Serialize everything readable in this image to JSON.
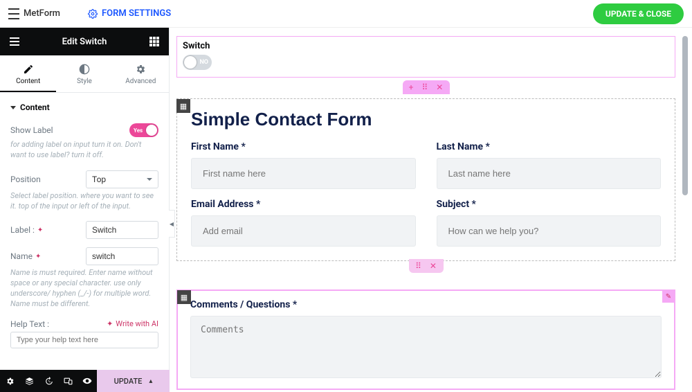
{
  "topbar": {
    "app_name": "MetForm",
    "form_settings": "FORM SETTINGS",
    "update_close": "UPDATE & CLOSE"
  },
  "panel": {
    "title": "Edit Switch",
    "tabs": {
      "content": "Content",
      "style": "Style",
      "advanced": "Advanced"
    }
  },
  "section": {
    "title": "Content"
  },
  "controls": {
    "show_label": {
      "label": "Show Label",
      "value": "Yes",
      "help": "for adding label on input turn it on. Don't want to use label? turn it off."
    },
    "position": {
      "label": "Position",
      "value": "Top",
      "help": "Select label position. where you want to see it. top of the input or left of the input."
    },
    "label_field": {
      "label": "Label :",
      "value": "Switch"
    },
    "name_field": {
      "label": "Name",
      "value": "switch",
      "help": "Name is must required. Enter name without space or any special character. use only underscore/ hyphen (_/-) for multiple word. Name must be different."
    },
    "help_text": {
      "label": "Help Text :",
      "ai_action": "Write with AI",
      "placeholder": "Type your help text here"
    }
  },
  "bottombar": {
    "update": "UPDATE"
  },
  "canvas": {
    "switch": {
      "label": "Switch",
      "off_text": "NO"
    },
    "form": {
      "title": "Simple Contact Form",
      "first_name": {
        "label": "First Name *",
        "placeholder": "First name here"
      },
      "last_name": {
        "label": "Last Name *",
        "placeholder": "Last name here"
      },
      "email": {
        "label": "Email Address *",
        "placeholder": "Add email"
      },
      "subject": {
        "label": "Subject *",
        "placeholder": "How can we help you?"
      },
      "comments": {
        "label": "Comments / Questions *",
        "placeholder": "Comments"
      }
    }
  }
}
